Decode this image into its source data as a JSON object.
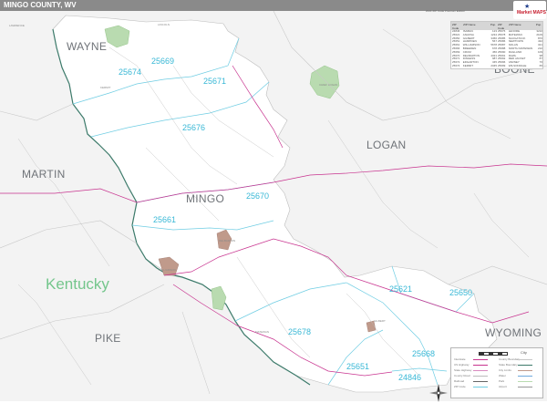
{
  "header": {
    "title": "MINGO COUNTY, WV",
    "edition": "2021 ZIP Code Premium Edition"
  },
  "counties": [
    {
      "id": "wayne",
      "label": "WAYNE"
    },
    {
      "id": "boone",
      "label": "BOONE"
    },
    {
      "id": "logan",
      "label": "LOGAN"
    },
    {
      "id": "martin",
      "label": "MARTIN"
    },
    {
      "id": "mingo",
      "label": "MINGO"
    },
    {
      "id": "pike",
      "label": "PIKE"
    },
    {
      "id": "wyoming",
      "label": "WYOMING"
    }
  ],
  "state_label": "Kentucky",
  "zip_codes": [
    {
      "id": "z25674",
      "code": "25674"
    },
    {
      "id": "z25669",
      "code": "25669"
    },
    {
      "id": "z25671",
      "code": "25671"
    },
    {
      "id": "z25676",
      "code": "25676"
    },
    {
      "id": "z25670",
      "code": "25670"
    },
    {
      "id": "z25661",
      "code": "25661"
    },
    {
      "id": "z25621",
      "code": "25621"
    },
    {
      "id": "z25650",
      "code": "25650"
    },
    {
      "id": "z25678",
      "code": "25678"
    },
    {
      "id": "z25651",
      "code": "25651"
    },
    {
      "id": "z25668",
      "code": "25668"
    },
    {
      "id": "z24846",
      "code": "24846"
    }
  ],
  "places": [
    {
      "id": "p1",
      "name": "LAWRENCE"
    },
    {
      "id": "p2",
      "name": "LINCOLN"
    },
    {
      "id": "p3",
      "name": "CHIEF LOGAN"
    },
    {
      "id": "p4",
      "name": "WILLIAMSON"
    },
    {
      "id": "p5",
      "name": "GILBERT"
    },
    {
      "id": "p6",
      "name": "DELBARTON"
    },
    {
      "id": "p7",
      "name": "MATEWAN"
    },
    {
      "id": "p8",
      "name": "KERMIT"
    }
  ],
  "zip_table": {
    "headers": [
      "ZIP Code",
      "ZIP Name",
      "Pop.",
      "ZIP Code",
      "ZIP Name",
      "Pop."
    ],
    "left": [
      [
        "24846",
        "ISABAN",
        "123"
      ],
      [
        "25621",
        "ANAKSA",
        "1234"
      ],
      [
        "25650",
        "GILBERT",
        "3456"
      ],
      [
        "25651",
        "HAMPDEN",
        "567"
      ],
      [
        "25661",
        "WILLIAMSON",
        "5678"
      ],
      [
        "25666",
        "BREEDEN",
        "678"
      ],
      [
        "25669",
        "CRUM",
        "456"
      ],
      [
        "25670",
        "DELBARTON",
        "4321"
      ],
      [
        "25671",
        "DINGESS",
        "987"
      ],
      [
        "25672",
        "EDGARTON",
        "345"
      ],
      [
        "25674",
        "KERMIT",
        "2345"
      ]
    ],
    "right": [
      [
        "25676",
        "LENORE",
        "3210"
      ],
      [
        "25678",
        "MATEWAN",
        "2109"
      ],
      [
        "25685",
        "NAUGATUCK",
        "876"
      ],
      [
        "25686",
        "NEWTOWN",
        "432"
      ],
      [
        "25687",
        "NOLAN",
        "321"
      ],
      [
        "25688",
        "NORTH MATEWAN",
        "210"
      ],
      [
        "25690",
        "RAGLAND",
        "109"
      ],
      [
        "25691",
        "RAWL",
        "98"
      ],
      [
        "25692",
        "RED JACKET",
        "87"
      ],
      [
        "25696",
        "VARNEY",
        "76"
      ],
      [
        "25699",
        "WILSONDALE",
        "65"
      ]
    ]
  },
  "legend": {
    "items_left": [
      "Interstate",
      "US Highway",
      "State Highway",
      "County Road",
      "Railroad",
      "ZIP Code"
    ],
    "items_right": [
      "County Boundary",
      "State Boundary",
      "City Limits",
      "Water",
      "Park",
      "Airport"
    ],
    "city_label": "City"
  },
  "brand": {
    "name": "Market MAPS"
  },
  "colors": {
    "county_fill": "#ffffff",
    "outside_fill": "#f3f3f3",
    "river": "#3c7a6a",
    "zip_line": "#6fcde3",
    "road_pink": "#c8338f",
    "green_area": "#b9dbb0",
    "urban_area": "#c09a8b",
    "text_gray": "#6f7378",
    "zip_text": "#39b8d6",
    "state_text": "#74c68c"
  }
}
